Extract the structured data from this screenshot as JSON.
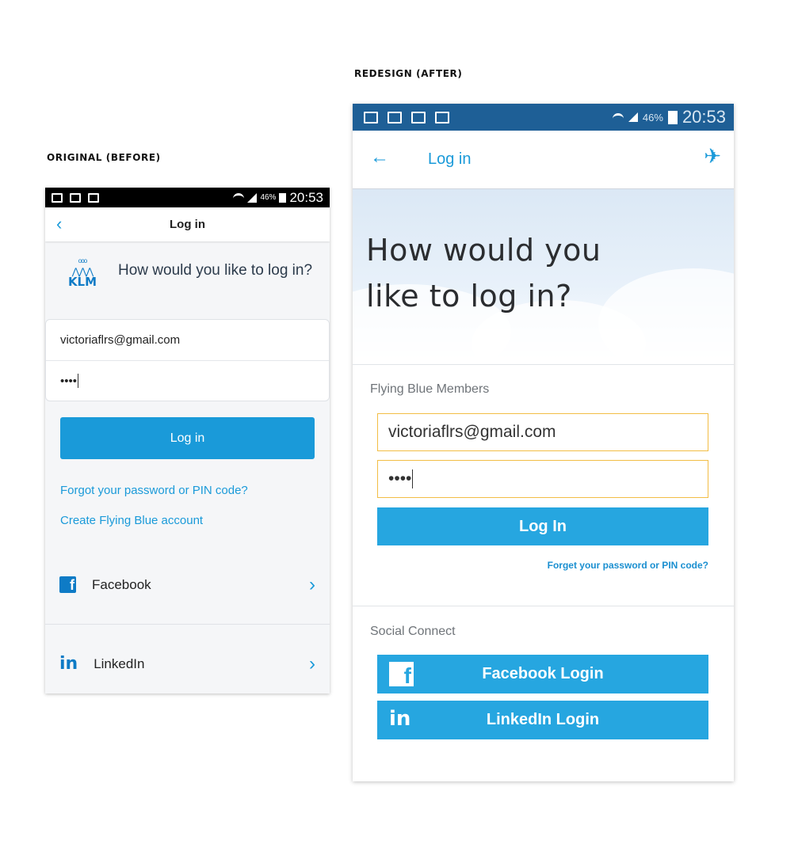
{
  "captions": {
    "after": "REDESIGN (AFTER)",
    "before": "ORIGINAL (BEFORE)"
  },
  "status_bar": {
    "battery": "46%",
    "time": "20:53"
  },
  "original": {
    "header_title": "Log in",
    "logo_text": "KLM",
    "question": "How would you like to log in?",
    "email_value": "victoriaflrs@gmail.com",
    "password_value": "••••",
    "login_button": "Log in",
    "forgot_link": "Forgot your password or PIN code?",
    "create_link": "Create Flying Blue account",
    "facebook_label": "Facebook",
    "linkedin_label": "LinkedIn",
    "colors": {
      "accent": "#1a9ad9",
      "brand": "#0e7bc6"
    }
  },
  "redesign": {
    "header_title": "Log in",
    "hero_line1": "How would you",
    "hero_line2": "like to log in?",
    "members_label": "Flying Blue Members",
    "email_value": "victoriaflrs@gmail.com",
    "password_value": "••••",
    "login_button": "Log In",
    "forgot_link": "Forget your password or PIN code?",
    "social_label": "Social Connect",
    "facebook_button": "Facebook Login",
    "linkedin_button": "LinkedIn Login",
    "colors": {
      "statusbar": "#1e5f96",
      "accent": "#26a6e0",
      "field_border": "#f2bd45"
    }
  }
}
